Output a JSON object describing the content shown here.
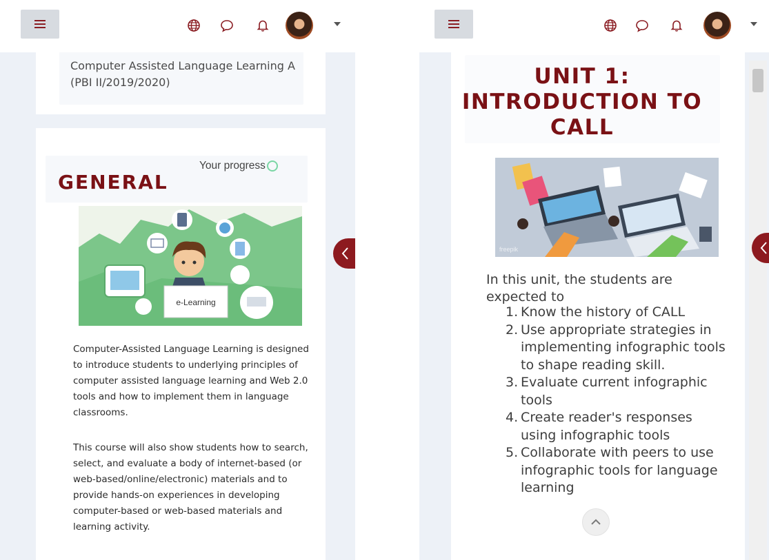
{
  "left_screen": {
    "course_title": "Computer Assisted Language Learning A (PBI II/2019/2020)",
    "section_heading": "GENERAL",
    "progress_label": "Your progress",
    "elearning_image_label": "e-Learning",
    "paragraph1": "Computer-Assisted Language Learning is designed to introduce students to underlying principles of computer assisted language learning and Web 2.0 tools and how to implement them in language classrooms.",
    "paragraph2": "This course will also show students how to search, select, and evaluate a body of internet-based (or web-based/online/electronic) materials and to provide hands-on experiences in developing computer-based or web-based materials and learning activity."
  },
  "right_screen": {
    "unit_title_line1": "UNIT 1:",
    "unit_title_line2": "INTRODUCTION TO",
    "unit_title_line3": "CALL",
    "image_watermark": "freepik",
    "intro_text": "In this unit, the students are expected to",
    "objectives": [
      {
        "num": "1.",
        "text": "Know the history of CALL"
      },
      {
        "num": "2.",
        "text": "Use appropriate strategies in implementing infographic tools to shape reading skill."
      },
      {
        "num": "3.",
        "text": "Evaluate current infographic tools"
      },
      {
        "num": "4.",
        "text": "Create reader's responses using infographic tools"
      },
      {
        "num": "5.",
        "text": "Collaborate with peers to use infographic tools for language learning"
      }
    ]
  },
  "icons": {
    "menu": "hamburger-menu-icon",
    "language": "globe-icon",
    "messages": "chat-bubble-icon",
    "notifications": "bell-icon",
    "user": "user-avatar",
    "dropdown": "caret-down-icon",
    "drawer": "chevron-left-icon",
    "back_to_top": "chevron-up-icon"
  },
  "colors": {
    "heading": "#7a1115",
    "drawer_toggle": "#8d1a1f",
    "menu_button": "#d7dbe0",
    "page_background": "#edf1f7",
    "progress_check": "#7ad6a4"
  }
}
